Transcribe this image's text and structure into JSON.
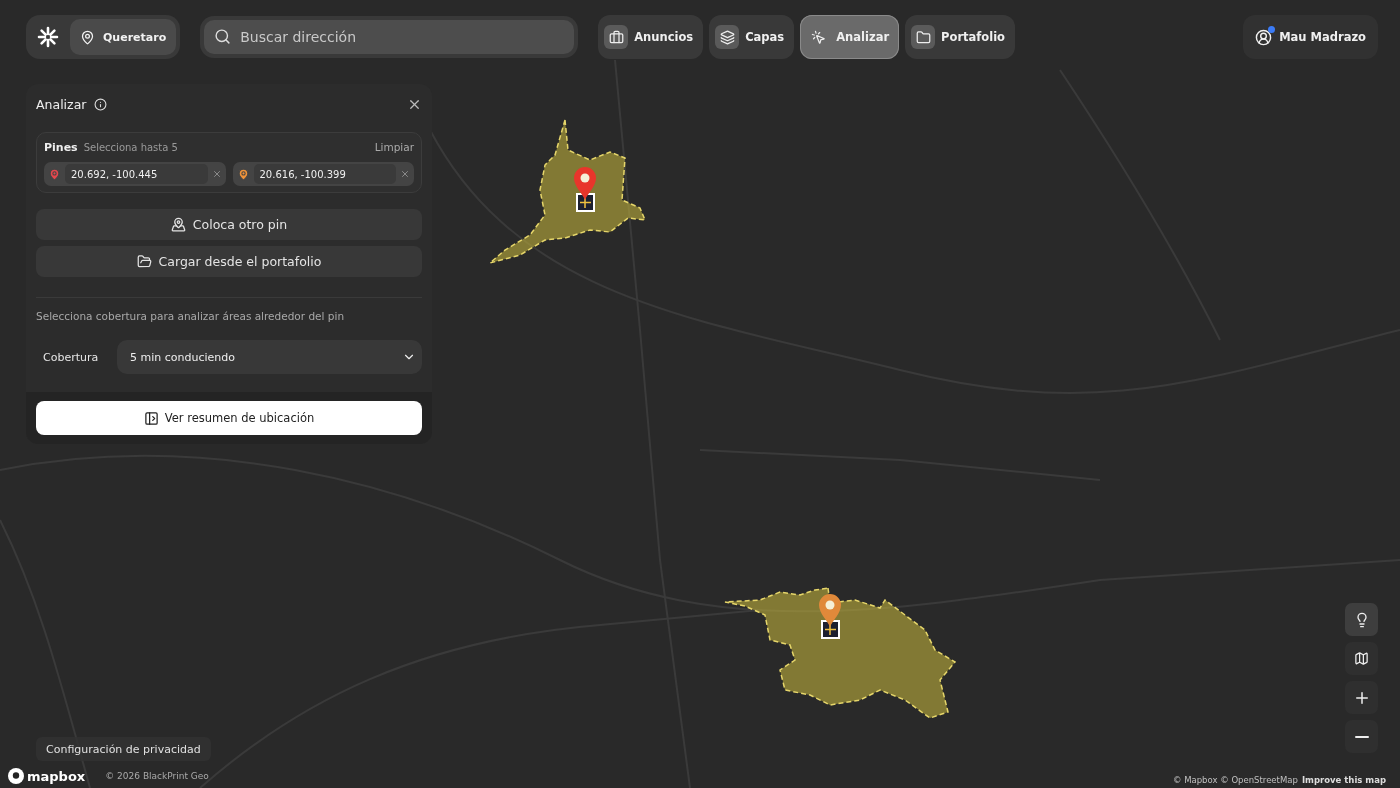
{
  "header": {
    "location": "Queretaro",
    "search": {
      "placeholder": "Buscar dirección"
    },
    "tabs": [
      {
        "label": "Anuncios",
        "kind": "briefcase",
        "selected": false
      },
      {
        "label": "Capas",
        "kind": "layers",
        "selected": false
      },
      {
        "label": "Analizar",
        "kind": "analyze",
        "selected": true
      },
      {
        "label": "Portafolio",
        "kind": "folder",
        "selected": false
      }
    ],
    "user": {
      "name": "Mau Madrazo",
      "notification": true
    }
  },
  "panel": {
    "title": "Analizar",
    "pins_label": "Pines",
    "pins_hint": "Selecciona hasta 5",
    "clear": "Limpiar",
    "pins": [
      {
        "value": "20.692, -100.445",
        "color": "#e5484d"
      },
      {
        "value": "20.616, -100.399",
        "color": "#f0933a"
      }
    ],
    "actions": [
      {
        "label": "Coloca otro pin",
        "kind": "pin"
      },
      {
        "label": "Cargar desde el portafolio",
        "kind": "folder"
      }
    ],
    "coverage_hint": "Selecciona cobertura para analizar áreas alrededor del pin",
    "coverage": {
      "label": "Cobertura",
      "value": "5 min conduciendo"
    },
    "summary_button": "Ver resumen de ubicación"
  },
  "map": {
    "markers": [
      {
        "color": "#e8352b"
      },
      {
        "color": "#e0893a"
      }
    ]
  },
  "footer": {
    "privacy": "Configuración de privacidad",
    "brand": "mapbox",
    "copyright": "© 2026 BlackPrint Geo",
    "attribution": "© Mapbox © OpenStreetMap",
    "improve": "Improve this map"
  }
}
